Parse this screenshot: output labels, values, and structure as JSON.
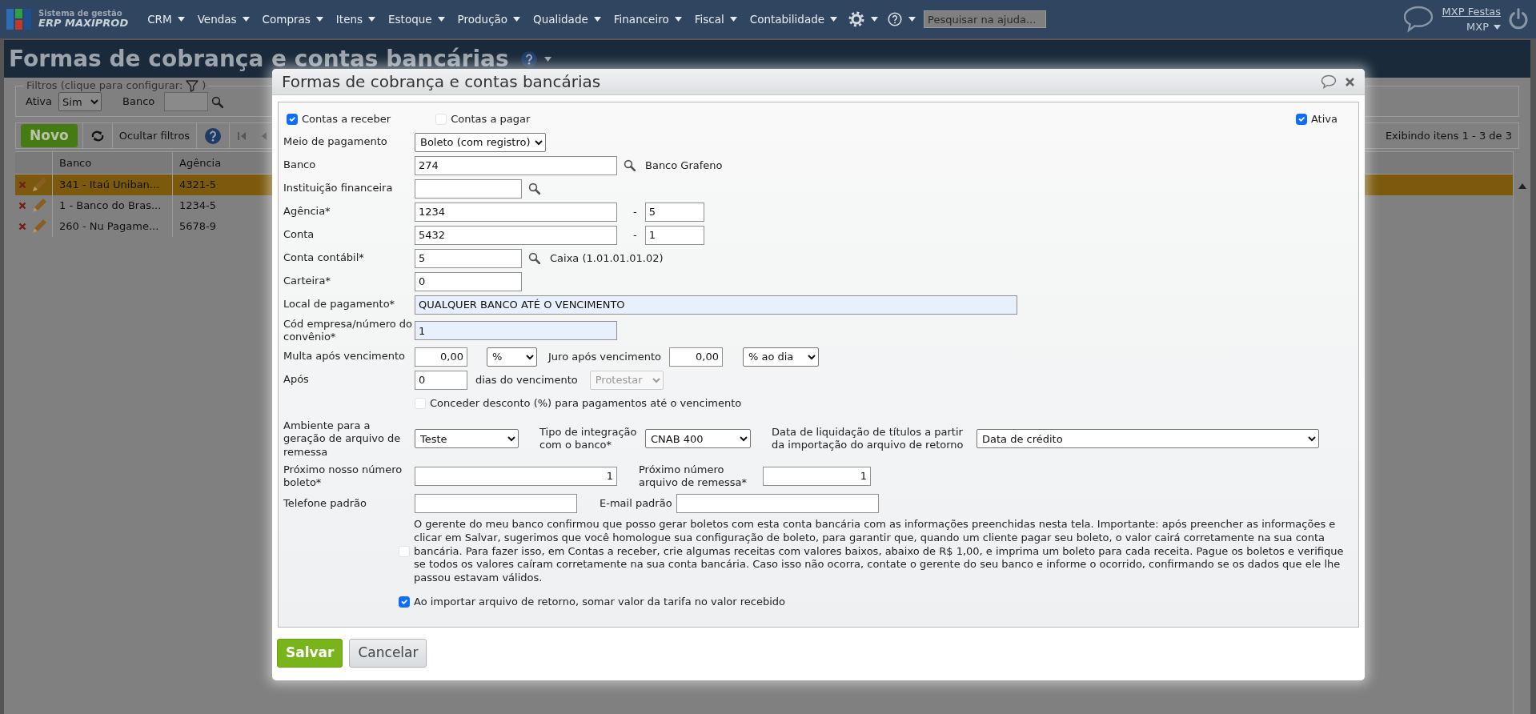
{
  "navbar": {
    "logo_line1": "Sistema de gestão",
    "logo_line2": "ERP MAXIPROD",
    "menus": [
      {
        "label": "CRM"
      },
      {
        "label": "Vendas"
      },
      {
        "label": "Compras"
      },
      {
        "label": "Itens"
      },
      {
        "label": "Estoque"
      },
      {
        "label": "Produção"
      },
      {
        "label": "Qualidade"
      },
      {
        "label": "Financeiro"
      },
      {
        "label": "Fiscal"
      },
      {
        "label": "Contabilidade"
      }
    ],
    "help_search": {
      "placeholder": "Pesquisar na ajuda..."
    },
    "company": "MXP Festas",
    "user": "MXP"
  },
  "page": {
    "title": "Formas de cobrança e contas bancárias",
    "filters": {
      "legend": "Filtros (clique para configurar:",
      "legend_close": ")",
      "active_label": "Ativa",
      "active_value": "Sim",
      "bank_label": "Banco"
    },
    "toolbar": {
      "new": "Novo",
      "toggle_filters": "Ocultar filtros",
      "pager_info": "Exibindo itens 1 - 3 de 3"
    },
    "grid": {
      "columns": [
        "Banco",
        "Agência"
      ],
      "rows": [
        {
          "bank": "341 - Itaú Uniban...",
          "agency": "4321-5",
          "selected": true
        },
        {
          "bank": "1 - Banco do Bras...",
          "agency": "1234-5",
          "selected": false
        },
        {
          "bank": "260 - Nu Pagame...",
          "agency": "5678-9",
          "selected": false
        }
      ]
    }
  },
  "modal": {
    "title": "Formas de cobrança e contas bancárias",
    "type_checks": [
      {
        "label": "Contas a receber",
        "checked": true
      },
      {
        "label": "Contas a pagar",
        "checked": false
      }
    ],
    "active": {
      "label": "Ativa",
      "checked": true
    },
    "payment_method": {
      "label": "Meio de pagamento",
      "value": "Boleto (com registro)"
    },
    "bank": {
      "label": "Banco",
      "value": "274",
      "lookup": "Banco Grafeno"
    },
    "institution": {
      "label": "Instituição financeira"
    },
    "agency": {
      "label": "Agência*",
      "value": "1234",
      "separator": "-",
      "digit": "5"
    },
    "account": {
      "label": "Conta",
      "value": "5432",
      "separator": "-",
      "digit": "1"
    },
    "ledger_account": {
      "label": "Conta contábil*",
      "value": "5",
      "lookup": "Caixa (1.01.01.01.02)"
    },
    "wallet": {
      "label": "Carteira*",
      "value": "0"
    },
    "payment_place": {
      "label": "Local de pagamento*",
      "value": "QUALQUER BANCO ATÉ O VENCIMENTO"
    },
    "agreement": {
      "label": "Cód empresa/número do convênio*",
      "value": "1"
    },
    "fine": {
      "label": "Multa após vencimento",
      "value": "0,00",
      "unit": "%"
    },
    "interest": {
      "label": "Juro após vencimento",
      "value": "0,00",
      "unit": "% ao dia"
    },
    "after": {
      "label": "Após",
      "value": "0",
      "suffix": "dias do vencimento",
      "action": "Protestar",
      "action_disabled": true
    },
    "discount": {
      "label": "Conceder desconto (%) para pagamentos até o vencimento",
      "checked": false
    },
    "environment": {
      "label": "Ambiente para a geração de arquivo de remessa",
      "value": "Teste"
    },
    "integration": {
      "label": "Tipo de integração com o banco*",
      "value": "CNAB 400"
    },
    "settlement_date": {
      "label": "Data de liquidação de títulos a partir da importação do arquivo de retorno",
      "value": "Data de crédito"
    },
    "next_boleto": {
      "label": "Próximo nosso número boleto*",
      "value": "1"
    },
    "next_remittance": {
      "label": "Próximo número arquivo de remessa*",
      "value": "1"
    },
    "phone": {
      "label": "Telefone padrão"
    },
    "email": {
      "label": "E-mail padrão"
    },
    "confirmation": {
      "text": "O gerente do meu banco confirmou que posso gerar boletos com esta conta bancária com as informações preenchidas nesta tela. Importante: após preencher as informações e clicar em Salvar, sugerimos que você homologue sua configuração de boleto, para garantir que, quando um cliente pagar seu boleto, o valor cairá corretamente na sua conta bancária. Para fazer isso, em Contas a receber, crie algumas receitas com valores baixos, abaixo de R$ 1,00, e imprima um boleto para cada receita. Pague os boletos e verifique se todos os valores caíram corretamente na sua conta bancária. Caso isso não ocorra, contate o gerente do seu banco e informe o ocorrido, confirmando se os dados que ele lhe passou estavam válidos.",
      "checked": false
    },
    "add_fee": {
      "label": "Ao importar arquivo de retorno, somar valor da tarifa no valor recebido",
      "checked": true
    },
    "buttons": {
      "save": "Salvar",
      "cancel": "Cancelar"
    }
  }
}
